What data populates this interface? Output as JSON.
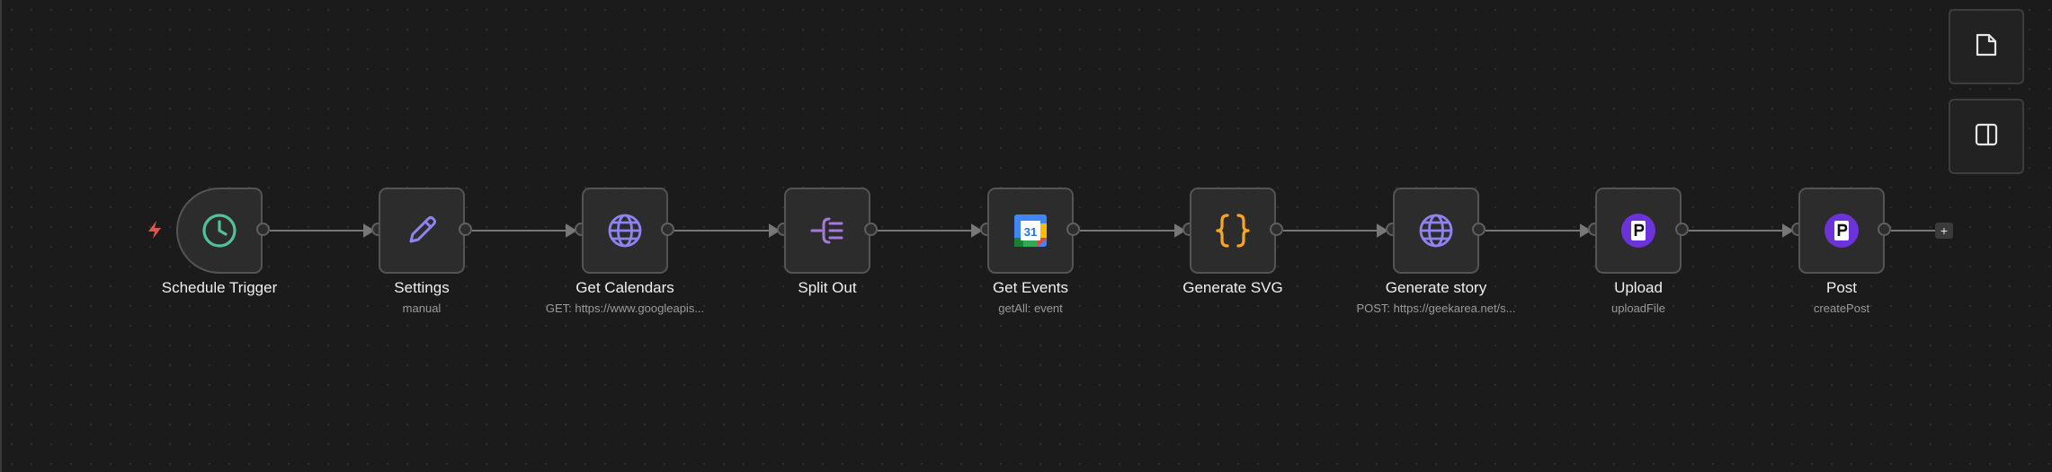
{
  "canvas": {
    "background": "#1b1b1b"
  },
  "nodes": [
    {
      "label": "Schedule Trigger",
      "subtitle": "",
      "icon": "clock-icon",
      "color": "#52c29a"
    },
    {
      "label": "Settings",
      "subtitle": "manual",
      "icon": "pencil-icon",
      "color": "#8f83f0"
    },
    {
      "label": "Get Calendars",
      "subtitle": "GET: https://www.googleapis...",
      "icon": "globe-icon",
      "color": "#8f83f0"
    },
    {
      "label": "Split Out",
      "subtitle": "",
      "icon": "split-out-icon",
      "color": "#a57bd9"
    },
    {
      "label": "Get Events",
      "subtitle": "getAll: event",
      "icon": "google-calendar-icon",
      "color": "#4285f4"
    },
    {
      "label": "Generate SVG",
      "subtitle": "",
      "icon": "code-braces-icon",
      "color": "#f5a623"
    },
    {
      "label": "Generate story",
      "subtitle": "POST: https://geekarea.net/s...",
      "icon": "globe-icon",
      "color": "#8f83f0"
    },
    {
      "label": "Upload",
      "subtitle": "uploadFile",
      "icon": "postiz-icon",
      "color": "#6b33d8"
    },
    {
      "label": "Post",
      "subtitle": "createPost",
      "icon": "postiz-icon",
      "color": "#6b33d8"
    }
  ],
  "trigger_icon": {
    "name": "lightning-icon",
    "color": "#e0554f"
  },
  "add_node": {
    "label": "+"
  },
  "side_toolbar": [
    {
      "icon": "sticky-note-icon"
    },
    {
      "icon": "side-panel-icon"
    }
  ]
}
